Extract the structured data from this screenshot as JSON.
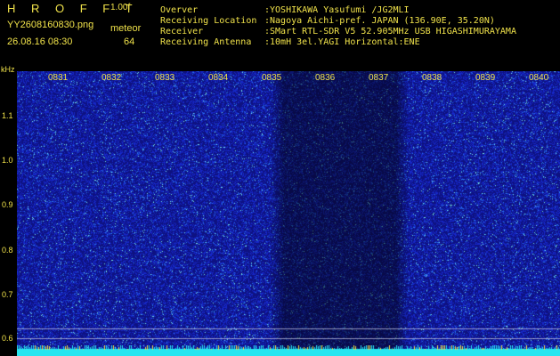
{
  "header": {
    "app_title": "H R O F F T",
    "version": "1.00f",
    "file_name": "YY2608160830.png",
    "meteor_label": "meteor",
    "meteor_count": "64",
    "date_time": "26.08.16 08:30"
  },
  "info": [
    {
      "key": "Overver",
      "value": ":YOSHIKAWA Yasufumi /JG2MLI"
    },
    {
      "key": "Receiving Location",
      "value": ":Nagoya Aichi-pref. JAPAN (136.90E, 35.20N)"
    },
    {
      "key": "Receiver",
      "value": ":SMart RTL-SDR V5 52.905MHz USB HIGASHIMURAYAMA"
    },
    {
      "key": "Receiving Antenna",
      "value": ":10mH 3el.YAGI Horizontal:ENE"
    }
  ],
  "axis": {
    "y_unit": "kHz",
    "y_ticks": [
      "1.1",
      "1.0",
      "0.9",
      "0.8",
      "0.7",
      "0.6"
    ],
    "x_ticks": [
      "0831",
      "0832",
      "0833",
      "0834",
      "0835",
      "0836",
      "0837",
      "0838",
      "0839",
      "0840"
    ]
  },
  "colors": {
    "text": "#f0e24a",
    "background": "#000000",
    "noise_base": "#1a22a8",
    "noise_dark": "#0c1058",
    "strip": "#27e6f0"
  }
}
